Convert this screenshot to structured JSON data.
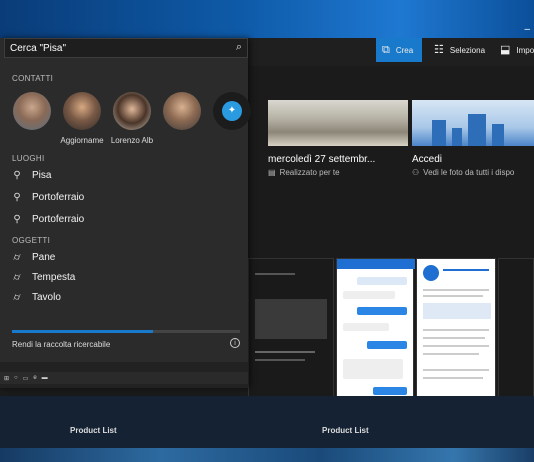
{
  "search": {
    "value": "Cerca \"Pisa\""
  },
  "sections": {
    "contacts": "CONTATTI",
    "places": "LUOGHI",
    "objects": "OGGETTI"
  },
  "contacts": [
    {
      "label": ""
    },
    {
      "label": "Aggiorname"
    },
    {
      "label": "Lorenzo Alb"
    },
    {
      "label": ""
    },
    {
      "label": ""
    }
  ],
  "places": [
    "Pisa",
    "Portoferraio",
    "Portoferraio"
  ],
  "objects": [
    "Pane",
    "Tempesta",
    "Tavolo"
  ],
  "reindex": {
    "label": "Rendi la raccolta ricercabile",
    "progress": 0.62
  },
  "commands": {
    "create": "Crea",
    "select": "Seleziona",
    "import": "Import"
  },
  "tiles": [
    {
      "title": "mercoledì 27 settembr...",
      "subtitle": "Realizzato per te"
    },
    {
      "title": "Accedi",
      "subtitle": "Vedi le foto da tutti i dispo"
    }
  ],
  "product": [
    "Product List",
    "Product List"
  ],
  "colors": {
    "accent": "#1979ca",
    "flyout": "#2b2b2b"
  }
}
